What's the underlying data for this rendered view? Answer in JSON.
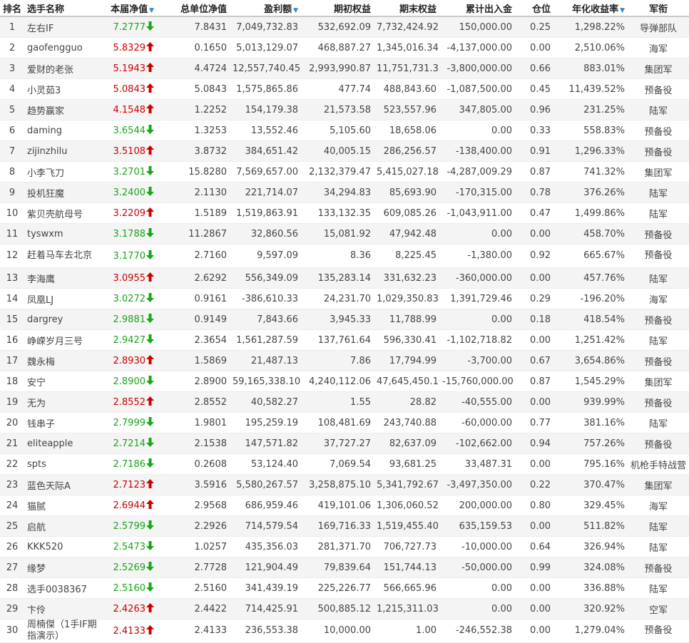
{
  "columns": {
    "rank": "排名",
    "name": "选手名称",
    "nav": "本届净值",
    "total_nav": "总单位净值",
    "profit": "盈利额",
    "start_equity": "期初权益",
    "end_equity": "期末权益",
    "net_flow": "累计出入金",
    "position": "仓位",
    "annual_return": "年化收益率",
    "army": "军衔"
  },
  "sort_icon": "triangle-down",
  "colors": {
    "up": "#cc0000",
    "down": "#1aa51a",
    "sort": "#2a88d8",
    "row_alt": "#f4f4f4"
  },
  "rows": [
    {
      "rank": "1",
      "name": "左右IF",
      "nav": "7.2777",
      "trend": "down",
      "total_nav": "7.8431",
      "profit": "7,049,732.83",
      "start_equity": "532,692.09",
      "end_equity": "7,732,424.92",
      "net_flow": "150,000.00",
      "position": "0.25",
      "annual_return": "1,298.22%",
      "army": "导弹部队"
    },
    {
      "rank": "2",
      "name": "gaofengguo",
      "nav": "5.8329",
      "trend": "up",
      "total_nav": "0.1650",
      "profit": "5,013,129.07",
      "start_equity": "468,887.27",
      "end_equity": "1,345,016.34",
      "net_flow": "-4,137,000.00",
      "position": "0.00",
      "annual_return": "2,510.06%",
      "army": "海军"
    },
    {
      "rank": "3",
      "name": "爱财的老张",
      "nav": "5.1943",
      "trend": "up",
      "total_nav": "4.4724",
      "profit": "12,557,740.45",
      "start_equity": "2,993,990.87",
      "end_equity": "11,751,731.32",
      "net_flow": "-3,800,000.00",
      "position": "0.66",
      "annual_return": "883.01%",
      "army": "集团军"
    },
    {
      "rank": "4",
      "name": "小灵茹3",
      "nav": "5.0843",
      "trend": "up",
      "total_nav": "5.0843",
      "profit": "1,575,865.86",
      "start_equity": "477.74",
      "end_equity": "488,843.60",
      "net_flow": "-1,087,500.00",
      "position": "0.45",
      "annual_return": "11,439.52%",
      "army": "预备役"
    },
    {
      "rank": "5",
      "name": "趋势赢家",
      "nav": "4.1548",
      "trend": "up",
      "total_nav": "1.2252",
      "profit": "154,179.38",
      "start_equity": "21,573.58",
      "end_equity": "523,557.96",
      "net_flow": "347,805.00",
      "position": "0.96",
      "annual_return": "231.25%",
      "army": "陆军"
    },
    {
      "rank": "6",
      "name": "daming",
      "nav": "3.6544",
      "trend": "down",
      "total_nav": "1.3253",
      "profit": "13,552.46",
      "start_equity": "5,105.60",
      "end_equity": "18,658.06",
      "net_flow": "0.00",
      "position": "0.33",
      "annual_return": "558.83%",
      "army": "预备役"
    },
    {
      "rank": "7",
      "name": "zijinzhilu",
      "nav": "3.5108",
      "trend": "up",
      "total_nav": "3.8732",
      "profit": "384,651.42",
      "start_equity": "40,005.15",
      "end_equity": "286,256.57",
      "net_flow": "-138,400.00",
      "position": "0.91",
      "annual_return": "1,296.33%",
      "army": "预备役"
    },
    {
      "rank": "8",
      "name": "小李飞刀",
      "nav": "3.2701",
      "trend": "down",
      "total_nav": "15.8280",
      "profit": "7,569,657.00",
      "start_equity": "2,132,379.47",
      "end_equity": "5,415,027.18",
      "net_flow": "-4,287,009.29",
      "position": "0.87",
      "annual_return": "741.32%",
      "army": "集团军"
    },
    {
      "rank": "9",
      "name": "投机狂魔",
      "nav": "3.2400",
      "trend": "down",
      "total_nav": "2.1130",
      "profit": "221,714.07",
      "start_equity": "34,294.83",
      "end_equity": "85,693.90",
      "net_flow": "-170,315.00",
      "position": "0.78",
      "annual_return": "376.26%",
      "army": "陆军"
    },
    {
      "rank": "10",
      "name": "紫贝壳航母号",
      "nav": "3.2209",
      "trend": "up",
      "total_nav": "1.5189",
      "profit": "1,519,863.91",
      "start_equity": "133,132.35",
      "end_equity": "609,085.26",
      "net_flow": "-1,043,911.00",
      "position": "0.47",
      "annual_return": "1,499.86%",
      "army": "陆军"
    },
    {
      "rank": "11",
      "name": "tyswxm",
      "nav": "3.1788",
      "trend": "down",
      "total_nav": "11.2867",
      "profit": "32,860.56",
      "start_equity": "15,081.92",
      "end_equity": "47,942.48",
      "net_flow": "0.00",
      "position": "0.00",
      "annual_return": "458.70%",
      "army": "预备役"
    },
    {
      "rank": "12",
      "name": "赶着马车去北京",
      "nav": "3.1770",
      "trend": "down",
      "total_nav": "2.7160",
      "profit": "9,597.09",
      "start_equity": "8.36",
      "end_equity": "8,225.45",
      "net_flow": "-1,380.00",
      "position": "0.92",
      "annual_return": "665.67%",
      "army": "预备役",
      "tall": true
    },
    {
      "rank": "13",
      "name": "李海鹰",
      "nav": "3.0955",
      "trend": "up",
      "total_nav": "2.6292",
      "profit": "556,349.09",
      "start_equity": "135,283.14",
      "end_equity": "331,632.23",
      "net_flow": "-360,000.00",
      "position": "0.00",
      "annual_return": "457.76%",
      "army": "陆军"
    },
    {
      "rank": "14",
      "name": "凤凰LJ",
      "nav": "3.0272",
      "trend": "down",
      "total_nav": "0.9161",
      "profit": "-386,610.33",
      "start_equity": "24,231.70",
      "end_equity": "1,029,350.83",
      "net_flow": "1,391,729.46",
      "position": "0.29",
      "annual_return": "-196.20%",
      "army": "海军"
    },
    {
      "rank": "15",
      "name": "dargrey",
      "nav": "2.9881",
      "trend": "down",
      "total_nav": "0.9149",
      "profit": "7,843.66",
      "start_equity": "3,945.33",
      "end_equity": "11,788.99",
      "net_flow": "0.00",
      "position": "0.18",
      "annual_return": "418.54%",
      "army": "预备役"
    },
    {
      "rank": "16",
      "name": "峥嵘岁月三号",
      "nav": "2.9427",
      "trend": "down",
      "total_nav": "2.3654",
      "profit": "1,561,287.59",
      "start_equity": "137,761.64",
      "end_equity": "596,330.41",
      "net_flow": "-1,102,718.82",
      "position": "0.00",
      "annual_return": "1,251.42%",
      "army": "陆军"
    },
    {
      "rank": "17",
      "name": "魏永梅",
      "nav": "2.8930",
      "trend": "up",
      "total_nav": "1.5869",
      "profit": "21,487.13",
      "start_equity": "7.86",
      "end_equity": "17,794.99",
      "net_flow": "-3,700.00",
      "position": "0.67",
      "annual_return": "3,654.86%",
      "army": "预备役"
    },
    {
      "rank": "18",
      "name": "安宁",
      "nav": "2.8900",
      "trend": "down",
      "total_nav": "2.8900",
      "profit": "59,165,338.10",
      "start_equity": "4,240,112.06",
      "end_equity": "47,645,450.16",
      "net_flow": "-15,760,000.00",
      "position": "0.87",
      "annual_return": "1,545.29%",
      "army": "集团军"
    },
    {
      "rank": "19",
      "name": "无为",
      "nav": "2.8552",
      "trend": "up",
      "total_nav": "2.8552",
      "profit": "40,582.27",
      "start_equity": "1.55",
      "end_equity": "28.82",
      "net_flow": "-40,555.00",
      "position": "0.00",
      "annual_return": "939.99%",
      "army": "预备役"
    },
    {
      "rank": "20",
      "name": "钱串子",
      "nav": "2.7999",
      "trend": "down",
      "total_nav": "1.9801",
      "profit": "195,259.19",
      "start_equity": "108,481.69",
      "end_equity": "243,740.88",
      "net_flow": "-60,000.00",
      "position": "0.77",
      "annual_return": "381.16%",
      "army": "陆军"
    },
    {
      "rank": "21",
      "name": "eliteapple",
      "nav": "2.7214",
      "trend": "down",
      "total_nav": "2.1538",
      "profit": "147,571.82",
      "start_equity": "37,727.27",
      "end_equity": "82,637.09",
      "net_flow": "-102,662.00",
      "position": "0.94",
      "annual_return": "757.26%",
      "army": "预备役"
    },
    {
      "rank": "22",
      "name": "spts",
      "nav": "2.7186",
      "trend": "down",
      "total_nav": "0.2608",
      "profit": "53,124.40",
      "start_equity": "7,069.54",
      "end_equity": "93,681.25",
      "net_flow": "33,487.31",
      "position": "0.00",
      "annual_return": "795.16%",
      "army": "机枪手特战营"
    },
    {
      "rank": "23",
      "name": "蓝色天际A",
      "nav": "2.7123",
      "trend": "up",
      "total_nav": "3.5916",
      "profit": "5,580,267.57",
      "start_equity": "3,258,875.10",
      "end_equity": "5,341,792.67",
      "net_flow": "-3,497,350.00",
      "position": "0.22",
      "annual_return": "370.47%",
      "army": "集团军"
    },
    {
      "rank": "24",
      "name": "猫腻",
      "nav": "2.6944",
      "trend": "up",
      "total_nav": "2.9568",
      "profit": "686,959.46",
      "start_equity": "419,101.06",
      "end_equity": "1,306,060.52",
      "net_flow": "200,000.00",
      "position": "0.80",
      "annual_return": "329.45%",
      "army": "海军"
    },
    {
      "rank": "25",
      "name": "启航",
      "nav": "2.5799",
      "trend": "down",
      "total_nav": "2.2926",
      "profit": "714,579.54",
      "start_equity": "169,716.33",
      "end_equity": "1,519,455.40",
      "net_flow": "635,159.53",
      "position": "0.00",
      "annual_return": "511.82%",
      "army": "陆军"
    },
    {
      "rank": "26",
      "name": "KKK520",
      "nav": "2.5473",
      "trend": "down",
      "total_nav": "1.0257",
      "profit": "435,356.03",
      "start_equity": "281,371.70",
      "end_equity": "706,727.73",
      "net_flow": "-10,000.00",
      "position": "0.64",
      "annual_return": "326.94%",
      "army": "陆军"
    },
    {
      "rank": "27",
      "name": "缘梦",
      "nav": "2.5269",
      "trend": "down",
      "total_nav": "2.7728",
      "profit": "121,904.49",
      "start_equity": "79,839.64",
      "end_equity": "151,744.13",
      "net_flow": "-50,000.00",
      "position": "0.99",
      "annual_return": "324.08%",
      "army": "预备役"
    },
    {
      "rank": "28",
      "name": "选手0038367",
      "nav": "2.5160",
      "trend": "down",
      "total_nav": "2.5160",
      "profit": "341,439.19",
      "start_equity": "225,226.77",
      "end_equity": "566,665.96",
      "net_flow": "0.00",
      "position": "0.00",
      "annual_return": "336.88%",
      "army": "陆军"
    },
    {
      "rank": "29",
      "name": "卞伶",
      "nav": "2.4263",
      "trend": "up",
      "total_nav": "2.4422",
      "profit": "714,425.91",
      "start_equity": "500,885.12",
      "end_equity": "1,215,311.03",
      "net_flow": "0.00",
      "position": "0.00",
      "annual_return": "320.92%",
      "army": "空军"
    },
    {
      "rank": "30",
      "name": "周楠傑（1手IF期指演示）",
      "nav": "2.4133",
      "trend": "up",
      "total_nav": "2.4133",
      "profit": "236,553.38",
      "start_equity": "10,000.00",
      "end_equity": "1.00",
      "net_flow": "-246,552.38",
      "position": "0.00",
      "annual_return": "1,279.04%",
      "army": "预备役",
      "tall": true
    }
  ]
}
